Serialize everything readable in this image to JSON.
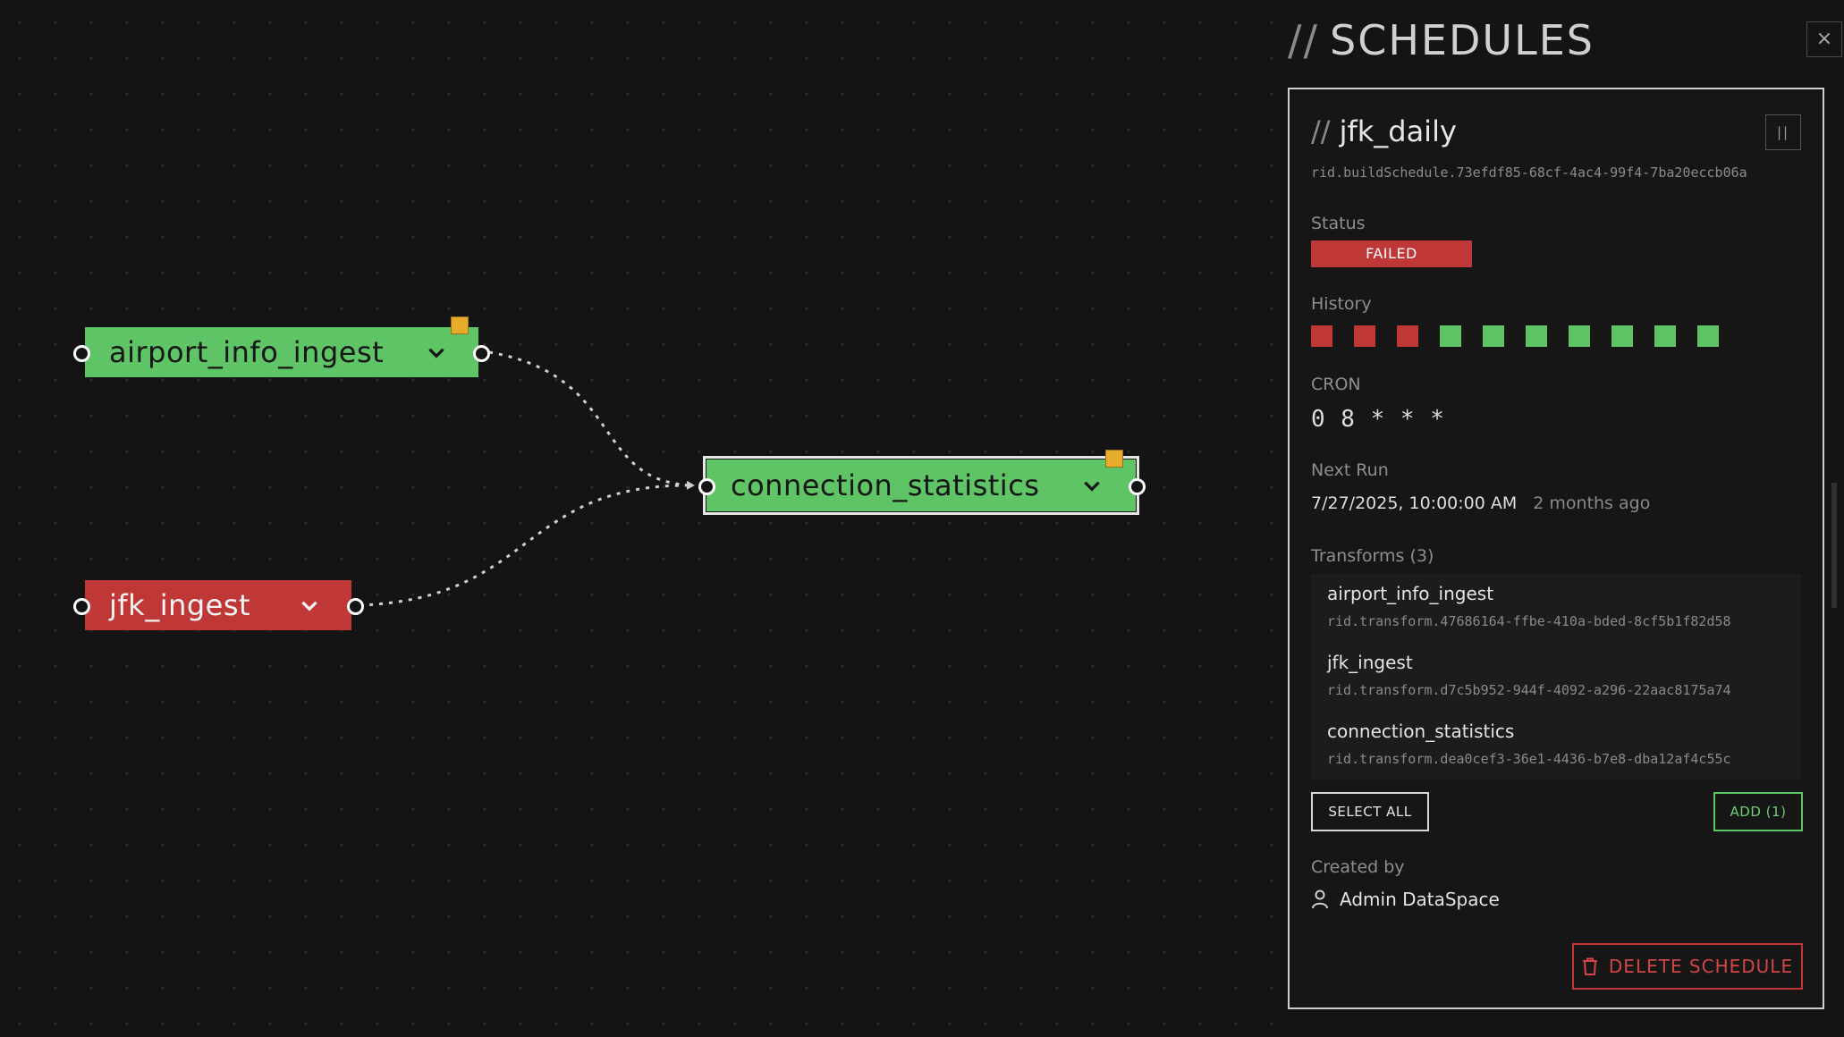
{
  "graph": {
    "nodes": [
      {
        "name": "airport_info_ingest",
        "status": "success",
        "has_badge": true
      },
      {
        "name": "connection_statistics",
        "status": "success",
        "has_badge": true,
        "selected": true
      },
      {
        "name": "jfk_ingest",
        "status": "failed",
        "has_badge": false
      }
    ],
    "edges": [
      {
        "from": "airport_info_ingest",
        "to": "connection_statistics",
        "style": "dashed"
      },
      {
        "from": "jfk_ingest",
        "to": "connection_statistics",
        "style": "dashed"
      }
    ]
  },
  "panel": {
    "title_prefix": "//",
    "title": "SCHEDULES",
    "close_icon": "×"
  },
  "schedule": {
    "name_prefix": "//",
    "name": "jfk_daily",
    "rid": "rid.buildSchedule.73efdf85-68cf-4ac4-99f4-7ba20eccb06a",
    "pause_icon": "||",
    "status_label": "Status",
    "status_value": "FAILED",
    "history_label": "History",
    "history": [
      "failed",
      "failed",
      "failed",
      "success",
      "success",
      "success",
      "success",
      "success",
      "success",
      "success"
    ],
    "cron_label": "CRON",
    "cron": "0 8 * * *",
    "next_run_label": "Next Run",
    "next_run": "7/27/2025, 10:00:00 AM",
    "next_run_relative": "2 months ago",
    "transforms_label": "Transforms (3)",
    "transforms": [
      {
        "name": "airport_info_ingest",
        "rid": "rid.transform.47686164-ffbe-410a-bded-8cf5b1f82d58"
      },
      {
        "name": "jfk_ingest",
        "rid": "rid.transform.d7c5b952-944f-4092-a296-22aac8175a74"
      },
      {
        "name": "connection_statistics",
        "rid": "rid.transform.dea0cef3-36e1-4436-b7e8-dba12af4c55c"
      }
    ],
    "select_all_label": "SELECT ALL",
    "add_label": "ADD (1)",
    "created_by_label": "Created by",
    "created_by": "Admin DataSpace",
    "delete_label": "DELETE SCHEDULE"
  },
  "colors": {
    "success": "#5ec466",
    "failed": "#c03737",
    "badge": "#e8ac2c",
    "background": "#141414"
  }
}
